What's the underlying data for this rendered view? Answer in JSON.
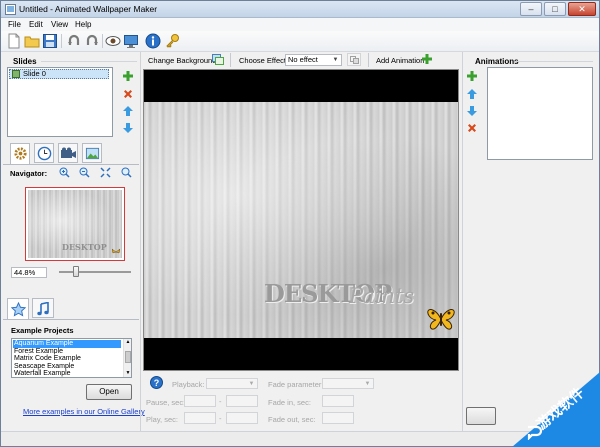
{
  "window": {
    "title": "Untitled - Animated Wallpaper Maker",
    "minimize": "–",
    "maximize": "□",
    "close": "✕"
  },
  "menu": [
    "File",
    "Edit",
    "View",
    "Help"
  ],
  "slides": {
    "title": "Slides",
    "items": [
      "Slide 0"
    ]
  },
  "background": {
    "change_label": "Change Background",
    "effect_label": "Choose Effect:",
    "effect_value": "No effect",
    "add_animation_label": "Add Animation"
  },
  "animations": {
    "title": "Animations"
  },
  "navigator": {
    "label": "Navigator:",
    "zoom": "44.8%",
    "zoom_fraction": 0.25
  },
  "examples": {
    "title": "Example Projects",
    "items": [
      "Aquarium Example",
      "Forest Example",
      "Matrix Code Example",
      "Seascape Example",
      "Waterfall Example"
    ],
    "selected_index": 0,
    "open_label": "Open",
    "more_link": "More examples in our Online Gallery"
  },
  "preview": {
    "brand_main": "DESKTOP",
    "brand_script": "Paints"
  },
  "params": {
    "playback": "Playback:",
    "fade_parameter": "Fade parameter:",
    "pause": "Pause, sec:",
    "fade_in": "Fade in, sec:",
    "play": "Play, sec:",
    "fade_out": "Fade out, sec:",
    "dash": "-"
  },
  "watermark": {
    "text": "游戏软件"
  },
  "colors": {
    "accent_blue": "#1e7fd1",
    "add_green": "#3aa12e",
    "delete_red": "#d84a1b",
    "watermark_blue": "#1e88e5"
  }
}
